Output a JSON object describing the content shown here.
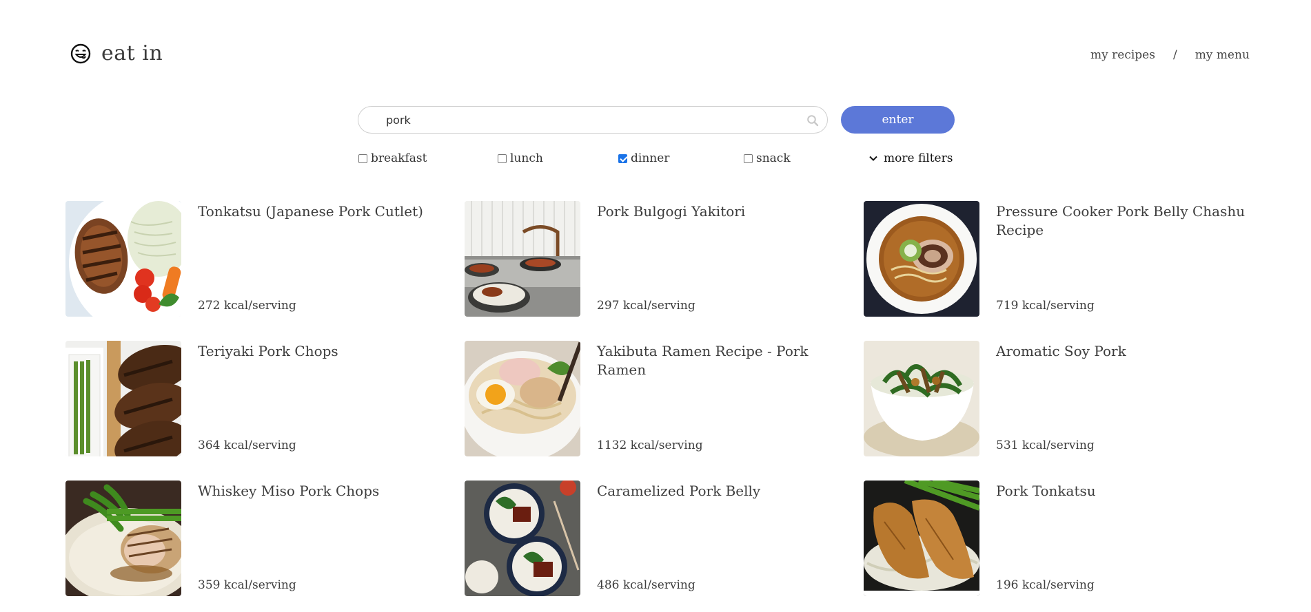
{
  "app": {
    "name": "eat in",
    "logo_icon": "smiley-face-icon"
  },
  "nav": {
    "my_recipes": "my recipes",
    "separator": "/",
    "my_menu": "my menu"
  },
  "search": {
    "value": "pork",
    "placeholder": "",
    "icon": "search-icon",
    "button_label": "enter",
    "button_color": "#5c78d8"
  },
  "filters": {
    "breakfast": {
      "label": "breakfast",
      "checked": false
    },
    "lunch": {
      "label": "lunch",
      "checked": false
    },
    "dinner": {
      "label": "dinner",
      "checked": true
    },
    "snack": {
      "label": "snack",
      "checked": false
    },
    "more": {
      "label": "more filters",
      "icon": "chevron-down-icon"
    }
  },
  "recipes": [
    {
      "title": "Tonkatsu (Japanese Pork Cutlet)",
      "kcal": "272 kcal/serving",
      "image": "tonkatsu-plate-image"
    },
    {
      "title": "Pork Bulgogi Yakitori",
      "kcal": "297 kcal/serving",
      "image": "bulgogi-table-image"
    },
    {
      "title": "Pressure Cooker Pork Belly Chashu Recipe",
      "kcal": "719 kcal/serving",
      "image": "ramen-bowl-image"
    },
    {
      "title": "Teriyaki Pork Chops",
      "kcal": "364 kcal/serving",
      "image": "pork-chops-image"
    },
    {
      "title": "Yakibuta Ramen Recipe - Pork Ramen",
      "kcal": "1132 kcal/serving",
      "image": "egg-ramen-image"
    },
    {
      "title": "Aromatic Soy Pork",
      "kcal": "531 kcal/serving",
      "image": "soy-pork-bowl-image"
    },
    {
      "title": "Whiskey Miso Pork Chops",
      "kcal": "359 kcal/serving",
      "image": "miso-chop-image"
    },
    {
      "title": "Caramelized Pork Belly",
      "kcal": "486 kcal/serving",
      "image": "pork-belly-bowls-image"
    },
    {
      "title": "Pork Tonkatsu",
      "kcal": "196 kcal/serving",
      "image": "fried-cutlet-image"
    }
  ]
}
